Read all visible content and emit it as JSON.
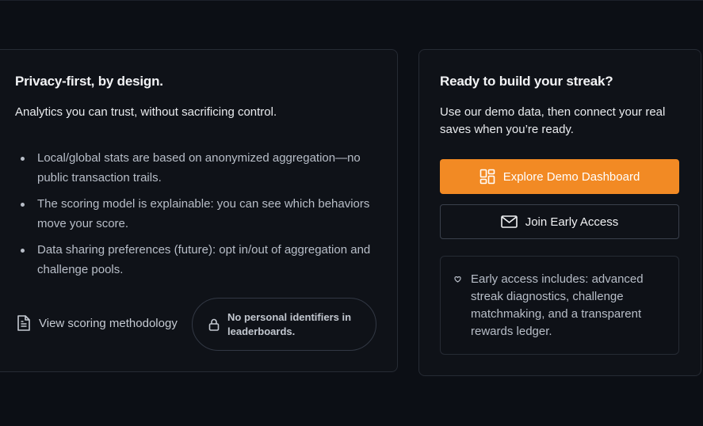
{
  "privacy": {
    "title": "Privacy-first, by design.",
    "subtitle": "Analytics you can trust, without sacrificing control.",
    "bullets": [
      "Local/global stats are based on anonymized aggregation—no public transaction trails.",
      "The scoring model is explainable: you can see which behaviors move your score.",
      "Data sharing preferences (future): opt in/out of aggregation and challenge pools."
    ],
    "methodology_link": "View scoring methodology",
    "badge_text": "No personal identifiers in leaderboards."
  },
  "cta": {
    "title": "Ready to build your streak?",
    "subtitle": "Use our demo data, then connect your real saves when you’re ready.",
    "primary_button": "Explore Demo Dashboard",
    "secondary_button": "Join Early Access",
    "note": "Early access includes: advanced streak diagnostics, challenge matchmaking, and a transparent rewards ledger."
  },
  "colors": {
    "accent": "#f28a24",
    "background": "#0c0f15",
    "card": "#0f1218"
  },
  "icons": {
    "methodology": "document-icon",
    "badge": "lock-icon",
    "primary_button": "dashboard-icon",
    "secondary_button": "mail-icon",
    "note": "heart-icon"
  }
}
